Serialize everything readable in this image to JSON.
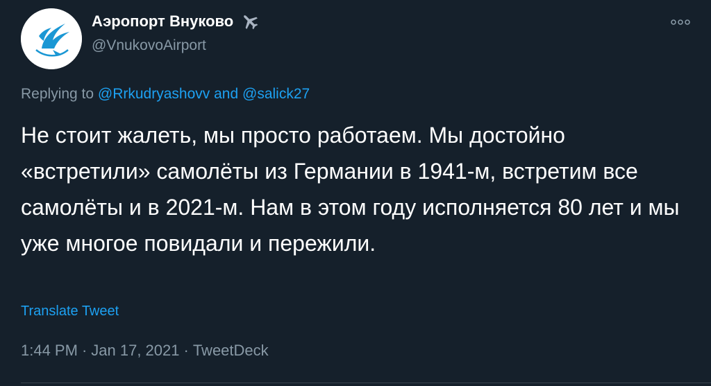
{
  "account": {
    "display_name": "Аэропорт Внуково",
    "handle": "@VnukovoAirport",
    "avatar_icon": "vnukovo-logo",
    "name_icon": "airplane-icon"
  },
  "replying": {
    "prefix": "Replying to",
    "user1": "@Rrkudryashovv",
    "and_text": "and",
    "user2": "@salick27"
  },
  "tweet": {
    "text": "Не стоит жалеть, мы просто работаем. Мы достойно «встретили» самолёты из Германии в 1941-м, встретим все самолёты и в 2021-м. Нам в этом году исполняется 80 лет и мы уже многое повидали и пережили.",
    "translate_label": "Translate Tweet"
  },
  "meta": {
    "time": "1:44 PM",
    "separator": "·",
    "date": "Jan 17, 2021",
    "source": "TweetDeck"
  },
  "colors": {
    "background": "#15202b",
    "text": "#ffffff",
    "secondary": "#8899a6",
    "link": "#1da1f2",
    "logo": "#1a97d4"
  }
}
